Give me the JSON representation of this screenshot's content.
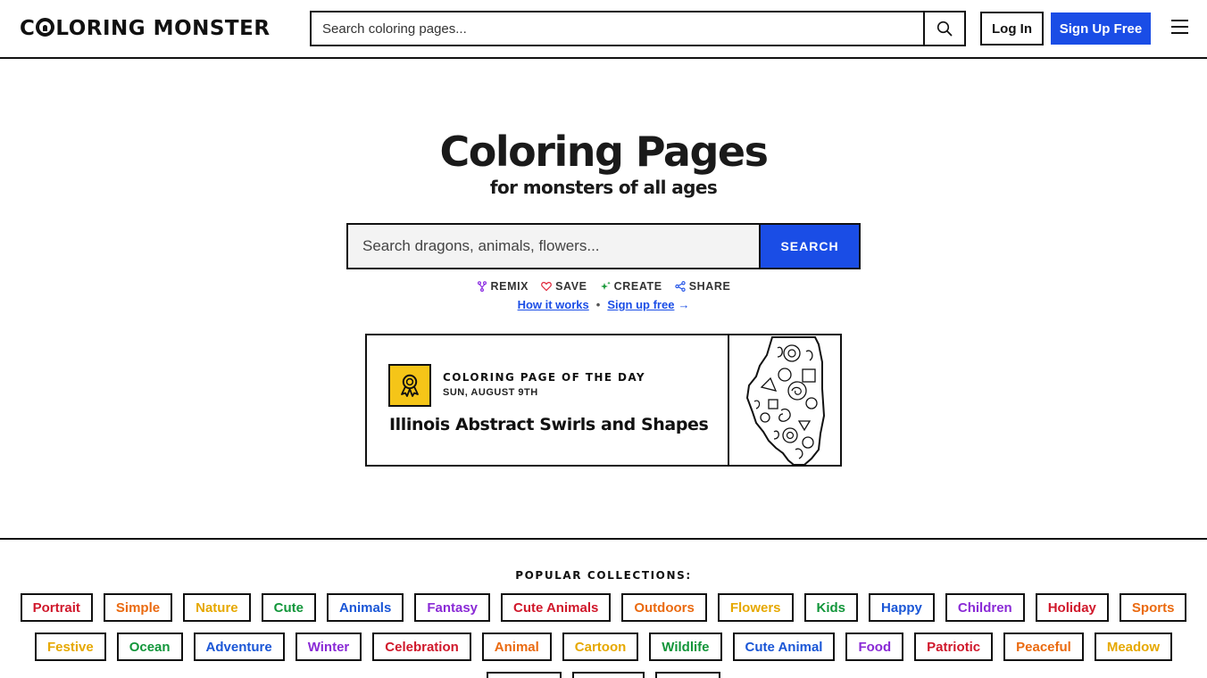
{
  "header": {
    "logo_text_1": "C",
    "logo_text_2": "LORING MONSTER",
    "search_placeholder": "Search coloring pages...",
    "login_label": "Log In",
    "signup_label": "Sign Up Free"
  },
  "hero": {
    "title": "Coloring Pages",
    "subtitle": "for monsters of all ages",
    "search_placeholder": "Search dragons, animals, flowers...",
    "search_button": "SEARCH",
    "features": [
      {
        "label": "REMIX",
        "icon": "fork-icon",
        "color": "#8a2be2"
      },
      {
        "label": "SAVE",
        "icon": "heart-icon",
        "color": "#e0253a"
      },
      {
        "label": "CREATE",
        "icon": "sparkle-icon",
        "color": "#1a9a3a"
      },
      {
        "label": "SHARE",
        "icon": "share-icon",
        "color": "#1a4de6"
      }
    ],
    "link_how": "How it works",
    "link_signup": "Sign up free",
    "link_separator": "•",
    "link_arrow": "→"
  },
  "day_card": {
    "kicker": "COLORING PAGE OF THE DAY",
    "date": "SUN, AUGUST 9TH",
    "title": "Illinois Abstract Swirls and Shapes",
    "badge_color": "#f5c518"
  },
  "collections": {
    "label": "POPULAR COLLECTIONS:",
    "row1": [
      {
        "label": "Portrait",
        "color": "#d0182b"
      },
      {
        "label": "Simple",
        "color": "#ea6a10"
      },
      {
        "label": "Nature",
        "color": "#e6a800"
      },
      {
        "label": "Cute",
        "color": "#12963a"
      },
      {
        "label": "Animals",
        "color": "#1a56d6"
      },
      {
        "label": "Fantasy",
        "color": "#8a2ad6"
      },
      {
        "label": "Cute Animals",
        "color": "#d0182b"
      },
      {
        "label": "Outdoors",
        "color": "#ea6a10"
      },
      {
        "label": "Flowers",
        "color": "#e6a800"
      },
      {
        "label": "Kids",
        "color": "#12963a"
      },
      {
        "label": "Happy",
        "color": "#1a56d6"
      },
      {
        "label": "Children",
        "color": "#8a2ad6"
      },
      {
        "label": "Holiday",
        "color": "#d0182b"
      },
      {
        "label": "Sports",
        "color": "#ea6a10"
      }
    ],
    "row2": [
      {
        "label": "Festive",
        "color": "#e6a800"
      },
      {
        "label": "Ocean",
        "color": "#12963a"
      },
      {
        "label": "Adventure",
        "color": "#1a56d6"
      },
      {
        "label": "Winter",
        "color": "#8a2ad6"
      },
      {
        "label": "Celebration",
        "color": "#d0182b"
      },
      {
        "label": "Animal",
        "color": "#ea6a10"
      },
      {
        "label": "Cartoon",
        "color": "#e6a800"
      },
      {
        "label": "Wildlife",
        "color": "#12963a"
      },
      {
        "label": "Cute Animal",
        "color": "#1a56d6"
      },
      {
        "label": "Food",
        "color": "#8a2ad6"
      },
      {
        "label": "Patriotic",
        "color": "#d0182b"
      },
      {
        "label": "Peaceful",
        "color": "#ea6a10"
      },
      {
        "label": "Meadow",
        "color": "#e6a800"
      }
    ]
  }
}
